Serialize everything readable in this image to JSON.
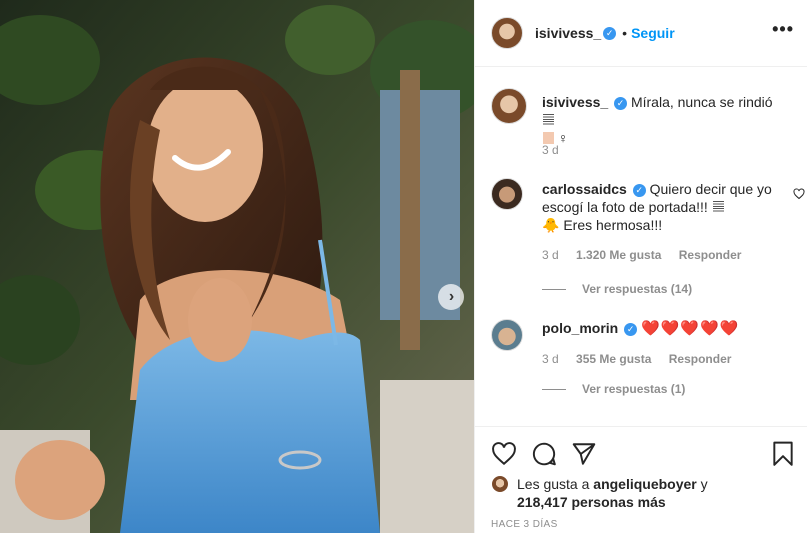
{
  "header": {
    "username": "isivivess_",
    "separator": "•",
    "follow_label": "Seguir",
    "more_label": "•••"
  },
  "caption": {
    "username": "isivivess_",
    "text": "Mírala, nunca se rindió",
    "suffix": "♀",
    "time": "3 d"
  },
  "comments": [
    {
      "username": "carlossaidcs",
      "text_1": "Quiero decir que yo escogí la foto de portada!!!",
      "emoji": "🐥",
      "text_2": "Eres hermosa!!!",
      "time": "3 d",
      "likes": "1.320 Me gusta",
      "reply_label": "Responder",
      "view_replies": "Ver respuestas (14)"
    },
    {
      "username": "polo_morin",
      "text": "❤️❤️❤️❤️❤️",
      "time": "3 d",
      "likes": "355 Me gusta",
      "reply_label": "Responder",
      "view_replies": "Ver respuestas (1)"
    }
  ],
  "likes_summary": {
    "prefix": "Les gusta a",
    "user": "angeliqueboyer",
    "joiner": "y",
    "count": "218,417 personas más"
  },
  "timestamp": "HACE 3 DÍAS",
  "icons": {
    "next": "chevron-right-icon",
    "verified": "verified-badge-icon",
    "like": "heart-outline-icon",
    "comment": "comment-bubble-icon",
    "share": "paper-plane-icon",
    "save": "bookmark-icon"
  },
  "colors": {
    "accent": "#0095f6",
    "verified": "#3897f0",
    "muted": "#8e8e8e",
    "text": "#262626",
    "heart": "#ed1c24"
  }
}
